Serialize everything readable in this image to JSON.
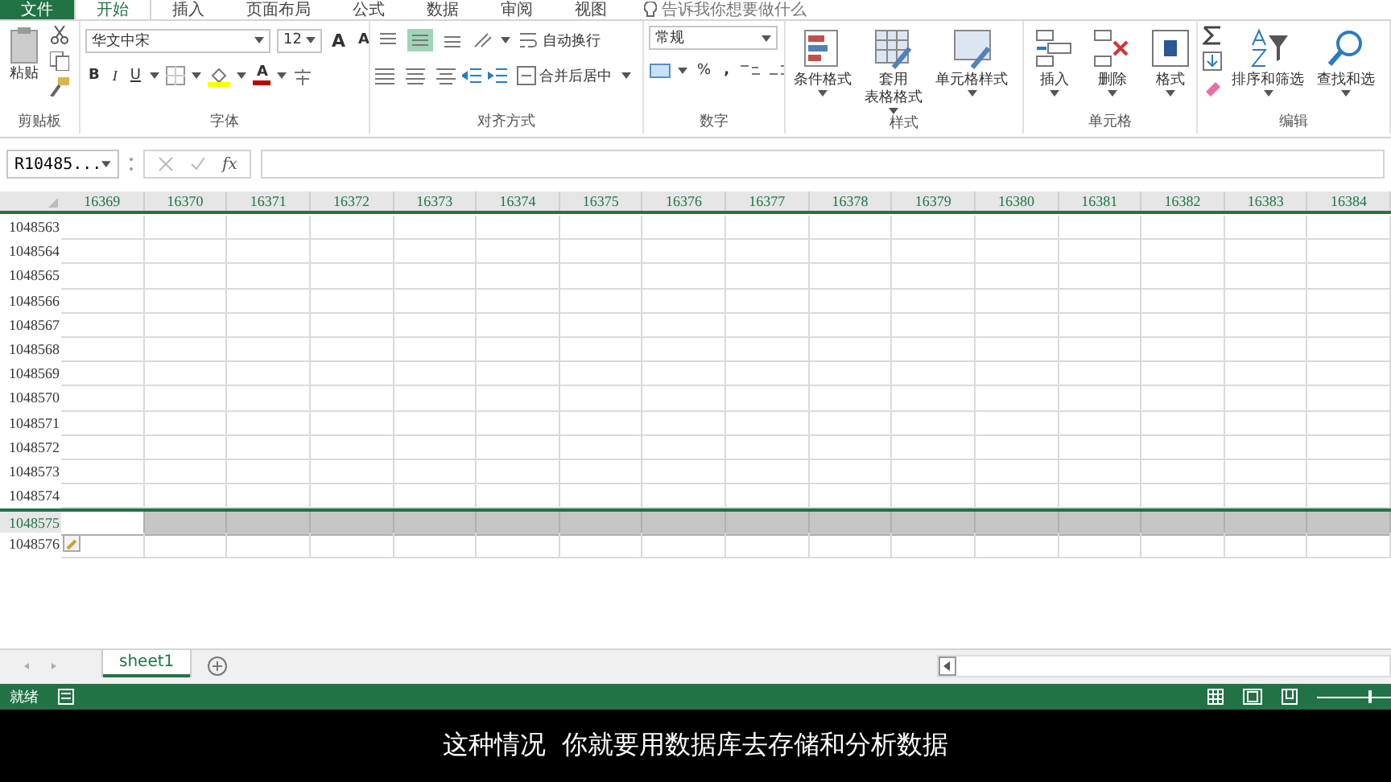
{
  "tabs": [
    {
      "label": "文件",
      "selected": false
    },
    {
      "label": "开始",
      "selected": true
    },
    {
      "label": "插入",
      "selected": false
    },
    {
      "label": "页面布局",
      "selected": false
    },
    {
      "label": "公式",
      "selected": false
    },
    {
      "label": "数据",
      "selected": false
    },
    {
      "label": "审阅",
      "selected": false
    },
    {
      "label": "视图",
      "selected": false
    }
  ],
  "tell_me": "告诉我你想要做什么",
  "ribbon": {
    "clipboard": {
      "paste": "粘贴",
      "label": "剪贴板"
    },
    "font": {
      "name": "华文中宋",
      "size": "12",
      "grow": "A",
      "shrink": "A",
      "bold": "B",
      "italic": "I",
      "underline": "U",
      "color_letter": "A",
      "label": "字体"
    },
    "align": {
      "vertical": [
        {
          "selected": false
        },
        {
          "selected": true
        },
        {
          "selected": false
        }
      ],
      "wrap": "自动换行",
      "merge": "合并后居中",
      "label": "对齐方式"
    },
    "number": {
      "format": "常规",
      "percent": "%",
      "comma": ",",
      "label": "数字"
    },
    "styles": {
      "buttons": [
        {
          "lines": [
            "条件格式"
          ],
          "kind": "conditional"
        },
        {
          "lines": [
            "套用",
            "表格格式"
          ],
          "kind": "table"
        },
        {
          "lines": [
            "单元格样式"
          ],
          "kind": "cellstyle"
        }
      ],
      "label": "样式"
    },
    "cells": {
      "buttons": [
        {
          "lines": [
            "插入"
          ],
          "kind": "insert"
        },
        {
          "lines": [
            "删除"
          ],
          "kind": "delete"
        },
        {
          "lines": [
            "格式"
          ],
          "kind": "format"
        }
      ],
      "label": "单元格"
    },
    "editing": {
      "buttons": [
        {
          "lines": [
            "排序和筛选"
          ],
          "kind": "sort"
        },
        {
          "lines": [
            "查找和选"
          ],
          "kind": "find"
        }
      ],
      "label": "编辑"
    }
  },
  "formula_bar": {
    "name_box": "R10485...",
    "fx": "fx"
  },
  "grid": {
    "columns": [
      "16369",
      "16370",
      "16371",
      "16372",
      "16373",
      "16374",
      "16375",
      "16376",
      "16377",
      "16378",
      "16379",
      "16380",
      "16381",
      "16382",
      "16383",
      "16384"
    ],
    "rows": [
      {
        "label": "1048563",
        "selected": false
      },
      {
        "label": "1048564",
        "selected": false
      },
      {
        "label": "1048565",
        "selected": false
      },
      {
        "label": "1048566",
        "selected": false
      },
      {
        "label": "1048567",
        "selected": false
      },
      {
        "label": "1048568",
        "selected": false
      },
      {
        "label": "1048569",
        "selected": false
      },
      {
        "label": "1048570",
        "selected": false
      },
      {
        "label": "1048571",
        "selected": false
      },
      {
        "label": "1048572",
        "selected": false
      },
      {
        "label": "1048573",
        "selected": false
      },
      {
        "label": "1048574",
        "selected": false
      },
      {
        "label": "1048575",
        "selected": true
      },
      {
        "label": "1048576",
        "selected": false
      }
    ]
  },
  "sheets": [
    {
      "label": "sheet1",
      "selected": true
    }
  ],
  "status_bar": {
    "text": "就绪",
    "zoom": {
      "level": 0.7
    }
  },
  "subtitle": "这种情况  你就要用数据库去存储和分析数据"
}
